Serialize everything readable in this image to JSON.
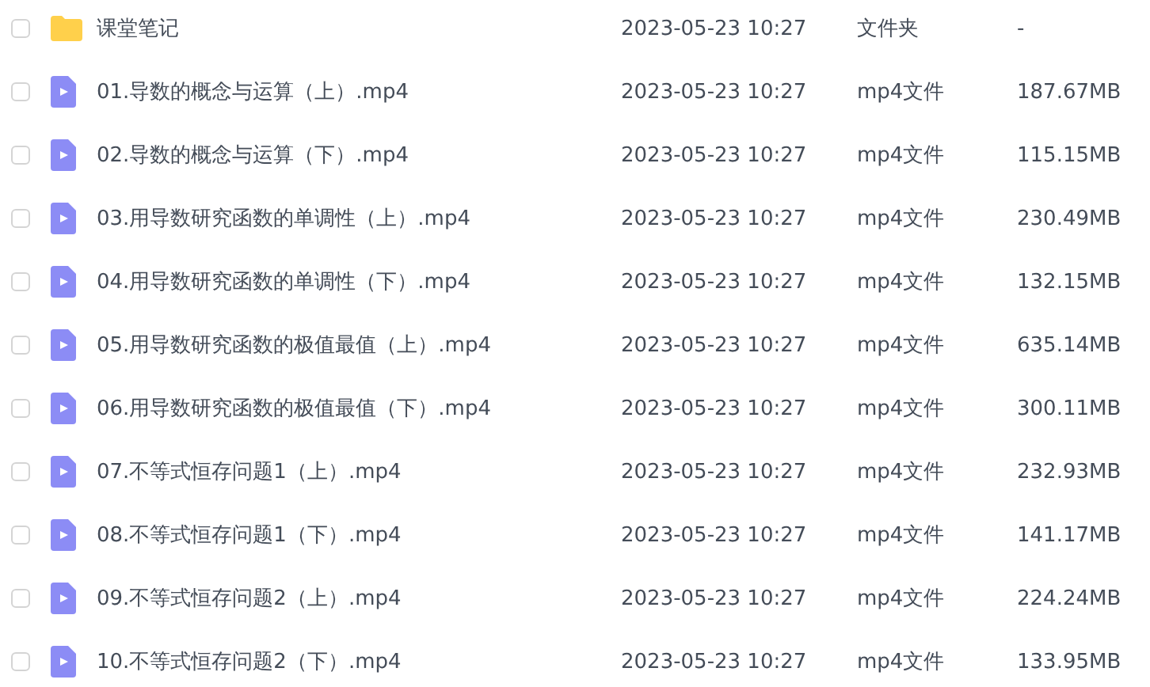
{
  "files": [
    {
      "kind": "folder",
      "checked": false,
      "name": "课堂笔记",
      "modified": "2023-05-23 10:27",
      "type": "文件夹",
      "size": "-"
    },
    {
      "kind": "video",
      "checked": false,
      "name": "01.导数的概念与运算（上）.mp4",
      "modified": "2023-05-23 10:27",
      "type": "mp4文件",
      "size": "187.67MB"
    },
    {
      "kind": "video",
      "checked": false,
      "name": "02.导数的概念与运算（下）.mp4",
      "modified": "2023-05-23 10:27",
      "type": "mp4文件",
      "size": "115.15MB"
    },
    {
      "kind": "video",
      "checked": false,
      "name": "03.用导数研究函数的单调性（上）.mp4",
      "modified": "2023-05-23 10:27",
      "type": "mp4文件",
      "size": "230.49MB"
    },
    {
      "kind": "video",
      "checked": false,
      "name": "04.用导数研究函数的单调性（下）.mp4",
      "modified": "2023-05-23 10:27",
      "type": "mp4文件",
      "size": "132.15MB"
    },
    {
      "kind": "video",
      "checked": false,
      "name": "05.用导数研究函数的极值最值（上）.mp4",
      "modified": "2023-05-23 10:27",
      "type": "mp4文件",
      "size": "635.14MB"
    },
    {
      "kind": "video",
      "checked": false,
      "name": "06.用导数研究函数的极值最值（下）.mp4",
      "modified": "2023-05-23 10:27",
      "type": "mp4文件",
      "size": "300.11MB"
    },
    {
      "kind": "video",
      "checked": false,
      "name": "07.不等式恒存问题1（上）.mp4",
      "modified": "2023-05-23 10:27",
      "type": "mp4文件",
      "size": "232.93MB"
    },
    {
      "kind": "video",
      "checked": false,
      "name": "08.不等式恒存问题1（下）.mp4",
      "modified": "2023-05-23 10:27",
      "type": "mp4文件",
      "size": "141.17MB"
    },
    {
      "kind": "video",
      "checked": false,
      "name": "09.不等式恒存问题2（上）.mp4",
      "modified": "2023-05-23 10:27",
      "type": "mp4文件",
      "size": "224.24MB"
    },
    {
      "kind": "video",
      "checked": false,
      "name": "10.不等式恒存问题2（下）.mp4",
      "modified": "2023-05-23 10:27",
      "type": "mp4文件",
      "size": "133.95MB"
    }
  ]
}
